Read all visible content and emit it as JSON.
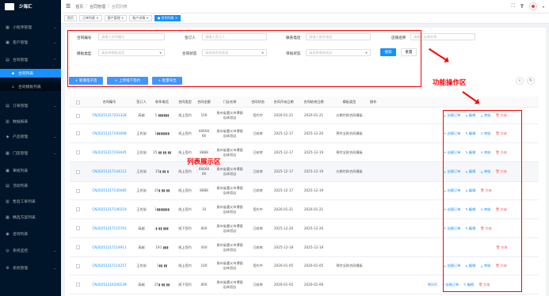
{
  "brand": {
    "name": "少海汇"
  },
  "sidebar": [
    {
      "label": "小程序管理",
      "icon": "grid-icon",
      "glyph": "▦"
    },
    {
      "label": "客户管理",
      "icon": "user-icon",
      "glyph": "▣"
    },
    {
      "label": "合同管理",
      "icon": "file-icon",
      "glyph": "▤"
    },
    {
      "label": "合同列表",
      "icon": "document-icon",
      "glyph": "▪"
    },
    {
      "label": "合同模板列表",
      "icon": "template-icon",
      "glyph": "▫"
    },
    {
      "label": "订单管理",
      "icon": "order-icon",
      "glyph": "▤"
    },
    {
      "label": "数据报表",
      "icon": "chart-icon",
      "glyph": "▥"
    },
    {
      "label": "产品管理",
      "icon": "product-icon",
      "glyph": "◈"
    },
    {
      "label": "门店管理",
      "icon": "store-icon",
      "glyph": "▦"
    },
    {
      "label": "审核列表",
      "icon": "audit-icon",
      "glyph": "▣"
    },
    {
      "label": "活动列表",
      "icon": "activity-icon",
      "glyph": "▤"
    },
    {
      "label": "售后工单列表",
      "icon": "ticket-icon",
      "glyph": "▥"
    },
    {
      "label": "精选方案列表",
      "icon": "plan-icon",
      "glyph": "▦"
    },
    {
      "label": "咨询列表",
      "icon": "consult-icon",
      "glyph": "◉"
    },
    {
      "label": "系统监控",
      "icon": "monitor-icon",
      "glyph": "◎"
    },
    {
      "label": "系统管理",
      "icon": "settings-icon",
      "glyph": "⚙"
    }
  ],
  "header": {
    "breadcrumb": [
      "首页",
      "合同管理",
      "合同列表"
    ]
  },
  "tabs": [
    {
      "label": "首页",
      "active": false
    },
    {
      "label": "订单列表 ×",
      "active": false
    },
    {
      "label": "客户管理 ×",
      "active": false
    },
    {
      "label": "账户详情 ×",
      "active": false
    },
    {
      "label": "● 合同列表 ×",
      "active": true
    }
  ],
  "filters": {
    "contract_no": {
      "label": "合同编号",
      "placeholder": "请输入合同编号"
    },
    "signer": {
      "label": "签订人",
      "placeholder": "请输入签订人"
    },
    "phone": {
      "label": "联系电话",
      "placeholder": "请输入联系电话"
    },
    "store": {
      "label": "店铺名称",
      "placeholder": "请输入店铺名称"
    },
    "template": {
      "label": "模板类型",
      "placeholder": "请选择模板类型"
    },
    "status": {
      "label": "合同状态",
      "placeholder": "请选择合同状态"
    },
    "audit": {
      "label": "审核状态",
      "placeholder": "请选择审核状态"
    },
    "search_label": "搜索",
    "reset_label": "重置"
  },
  "actions": {
    "add": "+ 新增电子签",
    "upload": "+ 上传线下签约",
    "export": "+ 批量导出"
  },
  "annotations": {
    "function_area": "功能操作区",
    "list_area": "列表展示区"
  },
  "table": {
    "headers": [
      "合同编号",
      "签订人",
      "联系电话",
      "合同类型",
      "合同金额",
      "门店名称",
      "合同状态",
      "合同开始日期",
      "合同结束日期",
      "模板类型",
      "操作"
    ],
    "ops": {
      "create": "创建订单",
      "edit": "编辑",
      "audit": "审核",
      "void": "作废"
    },
    "rows": [
      {
        "no": "CN20251217201328",
        "signer": "高越",
        "phone": "1 ▮▮▮▮▮▮",
        "type": "线上签约",
        "amount": "100",
        "store": "贵州省遵义市博昌店体验店",
        "status": "签约中",
        "start": "2026-01-21",
        "end": "2026-01-21",
        "tpl": "分期付款合同模板",
        "audit": true,
        "create": true,
        "edit": true,
        "extra": ""
      },
      {
        "no": "CN20251217193408",
        "signer": "王兆旭",
        "phone": "1▮▮▮▮▮▮▮",
        "type": "线上签约",
        "amount": "6666666",
        "store": "贵州省遵义市博昌店体验店",
        "status": "已结束",
        "start": "2025-12-17",
        "end": "2025-12-20",
        "tpl": "预付全款合同模板",
        "audit": true,
        "create": true,
        "edit": true,
        "extra": ""
      },
      {
        "no": "CN20251217193445",
        "signer": "王兆旭",
        "phone": "15 ▮▮ ▮▮ ▮▮",
        "type": "线上签约",
        "amount": "8888",
        "store": "贵州省遵义市博昌店体验店",
        "status": "已结束",
        "start": "2025-12-17",
        "end": "2025-12-19",
        "tpl": "预付全款合同模板",
        "audit": true,
        "create": true,
        "edit": true,
        "extra": ""
      },
      {
        "no": "CN20251217144112",
        "signer": "王兆旭",
        "phone": "15▮ ▮▮ ▮",
        "type": "线上签约",
        "amount": "6666666",
        "store": "贵州省遵义市博昌店体验店",
        "status": "已结束",
        "start": "2025-12-17",
        "end": "2025-12-19",
        "tpl": "分期付款合同模板",
        "audit": true,
        "create": true,
        "edit": true,
        "extra": ""
      },
      {
        "no": "CN20251217145085",
        "signer": "王兆旭",
        "phone": "15▮ ▮▮ ▮▮",
        "type": "线上签约",
        "amount": "8888",
        "store": "贵州省遵义市博昌店体验店",
        "status": "已结束",
        "start": "2025-12-17",
        "end": "2025-12-19",
        "tpl": "",
        "audit": false,
        "create": true,
        "edit": true,
        "extra": ""
      },
      {
        "no": "CN20251217140219",
        "signer": "王兆旭",
        "phone": "1▮▮▮▮▮▮▮",
        "type": "线上签约",
        "amount": "10",
        "store": "贵州省遵义市博昌店体验店",
        "status": "签约中",
        "start": "2026-01-21",
        "end": "2026-01-21",
        "tpl": "",
        "audit": true,
        "create": true,
        "edit": true,
        "extra": ""
      },
      {
        "no": "CN20251217115701",
        "signer": "高越",
        "phone": "▮ ▮▮ ▮▮▮",
        "type": "线下签约",
        "amount": "800",
        "store": "贵州省遵义市博昌店体验店",
        "status": "已结束",
        "start": "2025-12-26",
        "end": "2025-12-26",
        "tpl": "",
        "audit": false,
        "create": true,
        "edit": true,
        "extra": ""
      },
      {
        "no": "CN20251217114911",
        "signer": "高越",
        "phone": "191 ▮▮▮",
        "type": "线上签约",
        "amount": "400",
        "store": "贵州省遵义市博昌店体验店",
        "status": "已结束",
        "start": "2025-12-18",
        "end": "2025-12-18",
        "tpl": "",
        "audit": false,
        "create": false,
        "edit": false,
        "extra": ""
      },
      {
        "no": "CN20251217114257",
        "signer": "王兆旭",
        "phone": "1▮▮ ▮▮",
        "type": "线上签约",
        "amount": "100",
        "store": "贵州省遵义市博昌店体验店",
        "status": "签约中",
        "start": "2026-01-05",
        "end": "2026-01-05",
        "tpl": "预付全款合同模板",
        "audit": true,
        "create": true,
        "edit": true,
        "extra": ""
      },
      {
        "no": "CN20251216200139",
        "signer": "高越",
        "phone": "15▮ ▮▮ ▮▮",
        "type": "线下签约",
        "amount": "800",
        "store": "贵州省遵义市博昌店体验店",
        "status": "已结束",
        "start": "2026-01-05",
        "end": "2026-01-06",
        "tpl": "",
        "audit": false,
        "create": true,
        "edit": true,
        "extra": "NO20"
      }
    ]
  }
}
